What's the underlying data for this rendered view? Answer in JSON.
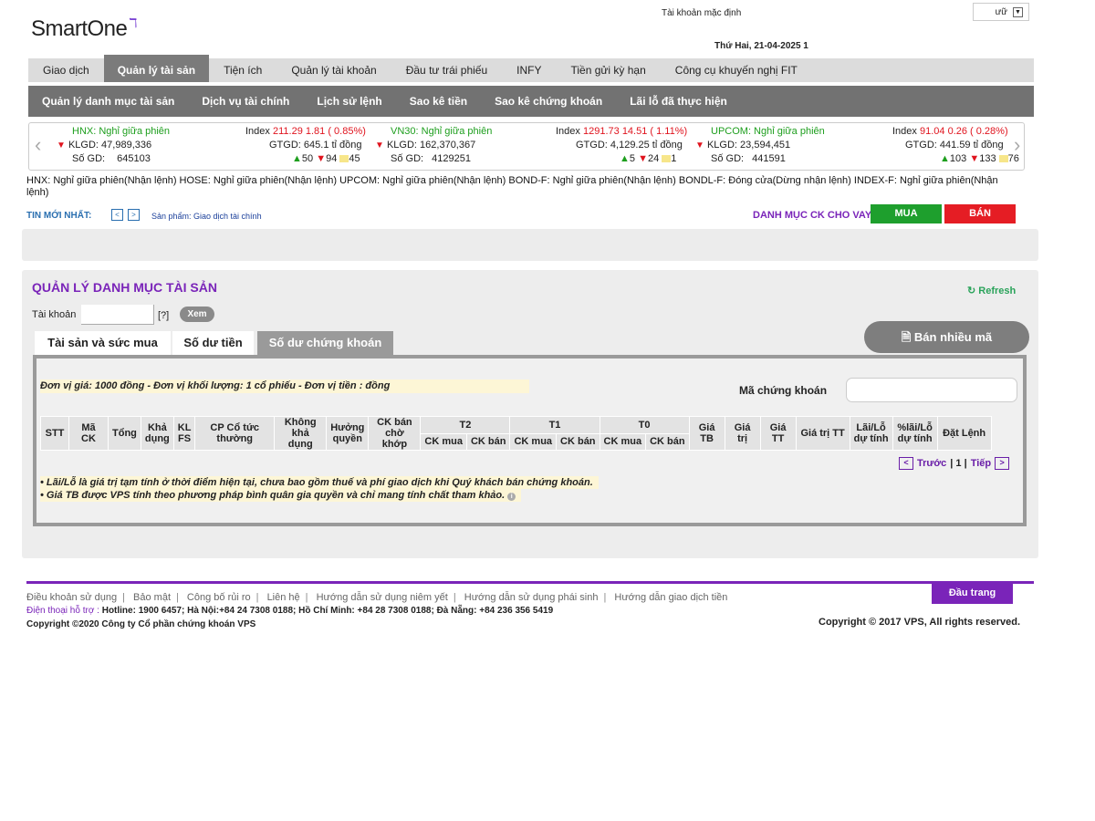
{
  "header": {
    "logo": "SmartOne",
    "account_default": "Tài khoản mặc định",
    "lang_value": "ưữ",
    "date": "Thứ Hai, 21-04-2025 1"
  },
  "mainnav": [
    "Giao dịch",
    "Quản lý tài sản",
    "Tiện ích",
    "Quản lý tài khoản",
    "Đầu tư trái phiếu",
    "INFY",
    "Tiền gửi kỳ hạn",
    "Công cụ khuyến nghị FIT"
  ],
  "subnav": [
    "Quản lý danh mục tài sản",
    "Dịch vụ tài chính",
    "Lịch sử lệnh",
    "Sao kê tiền",
    "Sao kê chứng khoán",
    "Lãi lỗ đã thực hiện"
  ],
  "ticker": [
    {
      "name": "HNX: Nghỉ giữa phiên",
      "index_label": "Index",
      "index_value": "211.29",
      "change": "1.81 ( 0.85%)",
      "klgd_label": "KLGD:",
      "klgd": "47,989,336",
      "gtgd_label": "GTGD:",
      "gtgd": "645.1 tỉ đồng",
      "sogd_label": "Số GD:",
      "sogd": "645103",
      "up": "50",
      "down": "94",
      "same": "45"
    },
    {
      "name": "VN30: Nghỉ giữa phiên",
      "index_label": "Index",
      "index_value": "1291.73",
      "change": "14.51 ( 1.11%)",
      "klgd_label": "KLGD:",
      "klgd": "162,370,367",
      "gtgd_label": "GTGD:",
      "gtgd": "4,129.25 tỉ đồng",
      "sogd_label": "Số GD:",
      "sogd": "4129251",
      "up": "5",
      "down": "24",
      "same": "1"
    },
    {
      "name": "UPCOM: Nghỉ giữa phiên",
      "index_label": "Index",
      "index_value": "91.04",
      "change": "0.26 ( 0.28%)",
      "klgd_label": "KLGD:",
      "klgd": "23,594,451",
      "gtgd_label": "GTGD:",
      "gtgd": "441.59 tỉ đồng",
      "sogd_label": "Số GD:",
      "sogd": "441591",
      "up": "103",
      "down": "133",
      "same": "76"
    }
  ],
  "status_line": "HNX: Nghỉ giữa phiên(Nhận lệnh)  HOSE: Nghỉ giữa phiên(Nhận lệnh)  UPCOM: Nghỉ giữa phiên(Nhận lệnh)  BOND-F: Nghỉ giữa phiên(Nhận lệnh)  BONDL-F: Đóng cửa(Dừng nhận lệnh)  INDEX-F: Nghỉ giữa phiên(Nhận lệnh)",
  "news": {
    "label": "TIN MỚI NHẤT:",
    "prev": "<",
    "next": ">",
    "product": "Sản phẩm: Giao dịch tài chính"
  },
  "loan_list": "DANH MỤC CK CHO VAY",
  "buy": "MUA",
  "sell": "BÁN",
  "panel": {
    "title": "QUẢN LÝ DANH MỤC TÀI SẢN",
    "refresh": "Refresh",
    "account_label": "Tài khoản",
    "account_value": "",
    "help": "[?]",
    "view": "Xem",
    "sell_multi": "Bán nhiều mã",
    "tabs": [
      "Tài sản và sức mua",
      "Số dư tiền",
      "Số dư chứng khoán"
    ],
    "unit_note": "Đơn vị giá: 1000 đồng - Đơn vị khối lượng: 1 cổ phiếu - Đơn vị tiền : đồng",
    "code_label": "Mã chứng khoán",
    "code_value": "",
    "columns": {
      "stt": "STT",
      "mack": "Mã CK",
      "tong": "Tổng",
      "khadung": "Khả dụng",
      "klfs": "KL FS",
      "cp": "CP Cổ tức thường",
      "khongkd": "Không khả dụng",
      "huongquyen": "Hưởng quyền",
      "ckban": "CK bán chờ khớp",
      "t2": "T2",
      "t1": "T1",
      "t0": "T0",
      "ckmua": "CK mua",
      "ckban2": "CK bán",
      "giatb": "Giá TB",
      "giatri": "Giá trị",
      "giatt": "Giá TT",
      "giatritt": "Giá trị TT",
      "lailo": "Lãi/Lỗ dự tính",
      "ptlailo": "%lãi/Lỗ dự tính",
      "datlenh": "Đặt Lệnh"
    },
    "pager": {
      "prev_icon": "<",
      "prev": "Trước",
      "page": "| 1 |",
      "next": "Tiếp",
      "next_icon": ">"
    },
    "notes": [
      "• Lãi/Lỗ là giá trị tạm tính ở thời điểm hiện tại, chưa bao gồm thuế và phí giao dịch khi Quý khách bán chứng khoán.",
      "• Giá TB được VPS tính theo phương pháp bình quân gia quyền và chỉ mang tính chất tham khảo."
    ]
  },
  "footer": {
    "links": [
      "Điều khoản sử dụng",
      "Bảo mật",
      "Công bố rủi ro",
      "Liên hệ",
      "Hướng dẫn sử dụng niêm yết",
      "Hướng dẫn sử dụng phái sinh",
      "Hướng dẫn giao dịch tiền"
    ],
    "phone_label": "Điện thoại hỗ trợ :",
    "phone": "Hotline: 1900 6457; Hà Nội:+84 24 7308 0188; Hồ Chí Minh: +84 28 7308 0188; Đà Nẵng: +84 236 356 5419",
    "copyright": "Copyright ©2020 Công ty Cổ phần chứng khoán VPS",
    "copyright2": "Copyright © 2017 VPS, All rights reserved.",
    "to_top": "Đầu trang"
  },
  "colors": {
    "purple": "#7a24b9",
    "green": "#1e9f2d",
    "red": "#e51d24"
  }
}
